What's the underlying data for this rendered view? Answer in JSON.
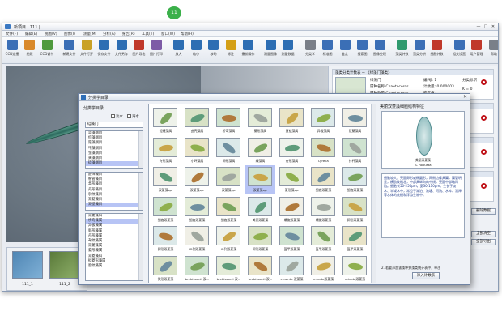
{
  "badge": "11",
  "window": {
    "title": "新项目 | 111 |",
    "min": "—",
    "max": "□",
    "close": "✕"
  },
  "menu": [
    "文件(F)",
    "编辑(E)",
    "视图(V)",
    "图像(I)",
    "测量(M)",
    "分析(A)",
    "报告(R)",
    "工具(T)",
    "窗口(W)",
    "帮助(H)"
  ],
  "toolbar": [
    "CCD连接",
    "拍照",
    "CCD调节",
    "新建文件",
    "文件打开",
    "保存文件",
    "文件另存",
    "图片导出",
    "图片打印",
    "放大",
    "缩小",
    "移动",
    "标注",
    "撤销操作",
    "测量图像",
    "测量数据",
    "分类学",
    "标准图",
    "鉴定",
    "搜索图",
    "图像处理",
    "藻类计数",
    "藻类分析",
    "细胞计数",
    "相关设置",
    "用户管理",
    "帮助"
  ],
  "thumbs": [
    {
      "label": "111_1"
    },
    {
      "label": "111_2"
    }
  ],
  "right_panel": {
    "card1": {
      "header": "藻类分类计数表 →  《绿藻门藻类》",
      "r1": "绿藻门",
      "r2": "属种名称 Chaetoceros",
      "r3": "属种数量 Chaetoceros",
      "v1": "编 号: 1",
      "v2": "计数量: 0.000003",
      "v3": "密度值: ",
      "k1": "分类标识",
      "k2": "K = 0"
    },
    "card2": {
      "header": "藻类分类计数表"
    },
    "card3": {
      "header": "藻类分类计数表"
    },
    "card4": {
      "header": "藻类分类计数表"
    },
    "btn_top": "删除数据",
    "btn_mid": "全部清空",
    "btn_bot": "全部导出"
  },
  "dialog": {
    "title": "分类学目录",
    "close": "✕",
    "left_label": "分类学目录",
    "chk1": "淡水",
    "chk2": "海水",
    "phylum": "硅藻门",
    "list1": [
      "蓝藻纲目",
      "红藻纲目",
      "隐藻纲目",
      "甲藻纲目",
      "金藻纲目",
      "黄藻纲目",
      "硅藻纲目"
    ],
    "list1_selected": 6,
    "list2": [
      "圆筛藻目",
      "根管藻目",
      "盒形藻目",
      "舟形藻目",
      "羽纹藻目",
      "双菱藻目",
      "双壁藻目"
    ],
    "list2_selected": 6,
    "list3": [
      "双菱藻科",
      "桥弯藻属",
      "异极藻属",
      "卵形藻属",
      "舟形藻属",
      "布纹藻属",
      "双菱藻属",
      "菱形藻属",
      "双菱藻科",
      "拟菱形藻属",
      "窗纹藻属"
    ],
    "list3_selected": 1,
    "grid": [
      [
        "短缝藻属",
        "曲壳藻属",
        "桥弯藻属",
        "菱形藻属",
        "直链藻属",
        "异极藻属",
        "双菱藻属"
      ],
      [
        "舟形藻属",
        "小环藻属",
        "卵形藻属",
        "绿藻属",
        "舟形藻属",
        "Lyrella",
        "针杆藻属"
      ],
      [
        "双菱藻sp.",
        "双菱藻sp.",
        "双菱藻sp.",
        "双菱藻sp.",
        "菱形藻sp.",
        "细齿双菱藻",
        "细齿双菱藻"
      ],
      [
        "细齿双菱藻",
        "细齿双菱藻",
        "细齿双菱藻",
        "美丽双菱藻",
        "螺旋双菱藻",
        "螺旋双菱藻",
        "卵形双菱藻"
      ],
      [
        "卵形双菱藻",
        "二列双菱藻",
        "二列双菱藻",
        "卵形双菱藻",
        "盔甲双菱藻",
        "盔甲双菱藻",
        "盔甲双菱藻"
      ],
      [
        "微形双菱藻",
        "brebissonii 双...",
        "brebissonii 双...",
        "brebissonii 双...",
        "cruenta 双菱藻",
        "minuta双菱藻",
        "minuta双菱藻"
      ]
    ],
    "detail_header": "美丽双菱藻细胞结构特征",
    "detail_name": "美丽双菱藻\nS. Robusta",
    "detail_text": "细胞较大，壳面卵形或椭圆形，两侧边缘具翼，翼管明显，横肋纹粗壮，中部具纵向的中线，壳面中部略凹陷。细胞长50-250μm，宽30-110μm。生长于淡水、半咸水中，常见于湖泊、池塘、河流、水库、沼泽等水体的底栖和浮游生物中。",
    "detail_note": "2. 若要添加该藻种到藻类统计表中，单击",
    "add_btn": "添入计数表"
  },
  "colors": {
    "accent": "#3a78c2",
    "status_red": "#c0141b",
    "selection": "#b7c4f5"
  }
}
